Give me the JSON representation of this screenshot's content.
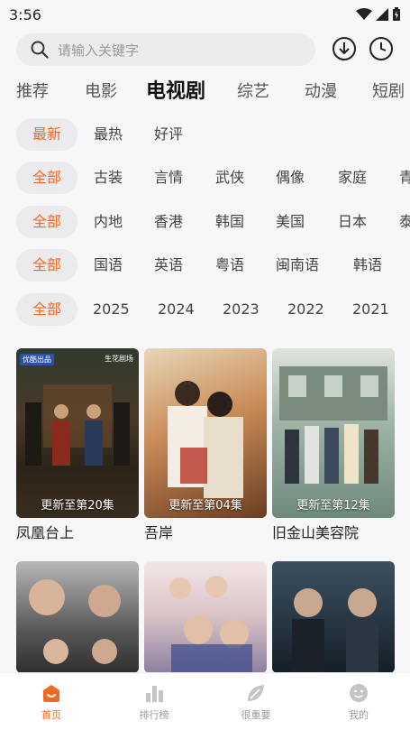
{
  "status": {
    "time": "3:56"
  },
  "search": {
    "placeholder": "请输入关键字"
  },
  "tabs": [
    "推荐",
    "电影",
    "电视剧",
    "综艺",
    "动漫",
    "短剧"
  ],
  "active_tab": "电视剧",
  "filters": {
    "sort": [
      "最新",
      "最热",
      "好评"
    ],
    "genre": [
      "全部",
      "古装",
      "言情",
      "武侠",
      "偶像",
      "家庭",
      "青"
    ],
    "region": [
      "全部",
      "内地",
      "香港",
      "韩国",
      "美国",
      "日本",
      "泰"
    ],
    "language": [
      "全部",
      "国语",
      "英语",
      "粤语",
      "闽南语",
      "韩语"
    ],
    "year": [
      "全部",
      "2025",
      "2024",
      "2023",
      "2022",
      "2021"
    ]
  },
  "posters": [
    {
      "title": "凤凰台上",
      "badge": "更新至第20集",
      "corner": "优酷出品",
      "brand": "生花剧场"
    },
    {
      "title": "吾岸",
      "badge": "更新至第04集"
    },
    {
      "title": "旧金山美容院",
      "badge": "更新至第12集"
    },
    {
      "title": "",
      "badge": ""
    },
    {
      "title": "",
      "badge": ""
    },
    {
      "title": "",
      "badge": ""
    }
  ],
  "bottom_nav": [
    {
      "label": "首页",
      "icon": "home-icon"
    },
    {
      "label": "排行榜",
      "icon": "bar-chart-icon"
    },
    {
      "label": "很重要",
      "icon": "leaf-icon"
    },
    {
      "label": "我的",
      "icon": "face-icon"
    }
  ],
  "colors": {
    "accent": "#f06a22",
    "background": "#f7f7f9"
  }
}
